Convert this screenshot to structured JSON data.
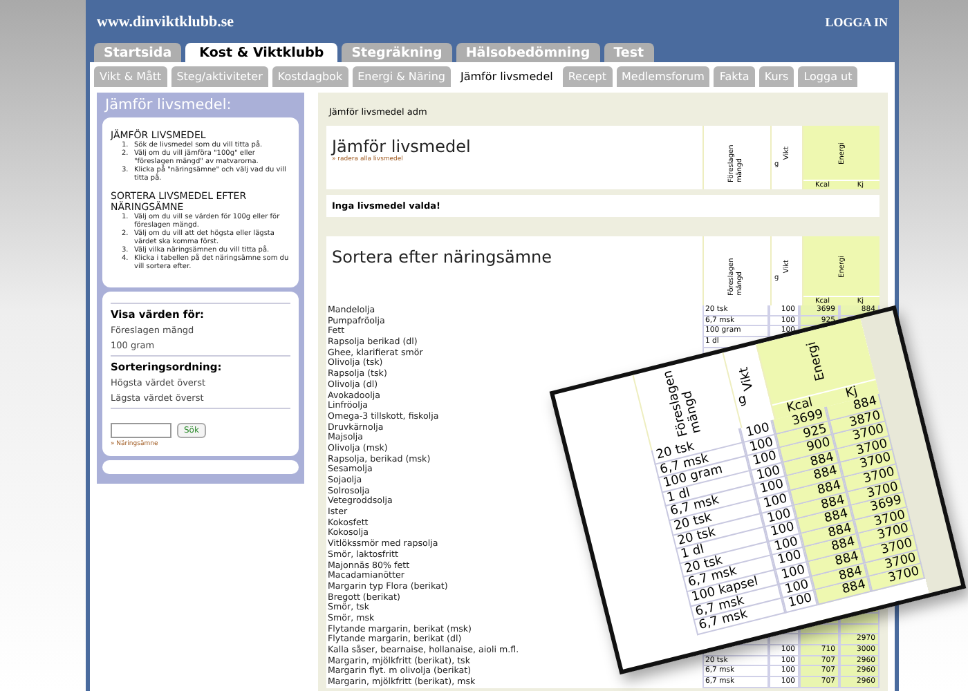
{
  "header": {
    "site": "www.dinviktklubb.se",
    "login": "LOGGA IN"
  },
  "tabs": [
    {
      "label": "Startsida",
      "selected": false
    },
    {
      "label": "Kost & Viktklubb",
      "selected": true
    },
    {
      "label": "Stegräkning",
      "selected": false
    },
    {
      "label": "Hälsobedömning",
      "selected": false
    },
    {
      "label": "Test",
      "selected": false
    }
  ],
  "subtabs": [
    {
      "label": "Vikt & Mått",
      "selected": false
    },
    {
      "label": "Steg/aktiviteter",
      "selected": false
    },
    {
      "label": "Kostdagbok",
      "selected": false
    },
    {
      "label": "Energi & Näring",
      "selected": false
    },
    {
      "label": "Jämför livsmedel",
      "selected": true
    },
    {
      "label": "Recept",
      "selected": false
    },
    {
      "label": "Medlemsforum",
      "selected": false
    },
    {
      "label": "Fakta",
      "selected": false
    },
    {
      "label": "Kurs",
      "selected": false
    },
    {
      "label": "Logga ut",
      "selected": false
    }
  ],
  "sidebar": {
    "title": "Jämför livsmedel:",
    "sections": [
      {
        "heading": "JÄMFÖR LIVSMEDEL",
        "steps": [
          {
            "number": "1.",
            "text": "Sök de livsmedel som du vill titta på."
          },
          {
            "number": "2.",
            "text": "Välj om du vill jämföra \"100g\" eller \"föreslagen mängd\" av matvarorna."
          },
          {
            "number": "3.",
            "text": "Klicka på \"näringsämne\" och välj vad du vill titta på."
          }
        ]
      },
      {
        "heading": "SORTERA LIVSMEDEL EFTER NÄRINGSÄMNE",
        "steps": [
          {
            "number": "1.",
            "text": "Välj om du vill se värden för 100g eller för föreslagen mängd."
          },
          {
            "number": "2.",
            "text": "Välj om du vill att det högsta eller lägsta värdet ska komma först."
          },
          {
            "number": "3.",
            "text": "Välj vilka näringsämnen du vill titta på."
          },
          {
            "number": "4.",
            "text": "Klicka i tabellen på det näringsämne som du vill sortera efter."
          }
        ]
      }
    ],
    "options": [
      {
        "kind": "heading",
        "text": "Visa värden för:"
      },
      {
        "kind": "option",
        "text": "Föreslagen mängd"
      },
      {
        "kind": "option",
        "text": "100 gram"
      },
      {
        "kind": "heading",
        "text": "Sorteringsordning:"
      },
      {
        "kind": "option",
        "text": "Högsta värdet överst"
      },
      {
        "kind": "option",
        "text": "Lägsta värdet överst"
      }
    ],
    "search_button": "Sök",
    "link": "» Näringsämne"
  },
  "main": {
    "title": "Jämför livsmedel adm",
    "compare": {
      "heading": "Jämför livsmedel",
      "link": "» radera alla livsmedel",
      "columns": {
        "amount": "Föreslagen mängd",
        "weight": "Vikt",
        "unit": "g",
        "energy": "Energi",
        "kcal": "Kcal",
        "kj": "Kj"
      }
    },
    "message": "Inga livsmedel valda!",
    "sort": {
      "heading": "Sortera efter näringsämne",
      "columns": {
        "amount": "Föreslagen mängd",
        "weight": "Vikt",
        "unit": "g",
        "energy": "Energi",
        "kcal": "Kcal",
        "kj": "Kj"
      },
      "rows": [
        {
          "name": "Mandelolja",
          "amount": "20 tsk",
          "weight": "100",
          "kcal": "3699",
          "kj": "884"
        },
        {
          "name": "Pumpafröolja",
          "amount": "6,7 msk",
          "weight": "100",
          "kcal": "925"
        },
        {
          "name": "Fett",
          "amount": "100 gram",
          "weight": "100"
        },
        {
          "name": "Rapsolja berikad (dl)",
          "amount": "1 dl"
        },
        {
          "name": "Ghee, klarifierat smör"
        },
        {
          "name": "Olivolja (tsk)"
        },
        {
          "name": "Rapsolja (tsk)"
        },
        {
          "name": "Olivolja (dl)"
        },
        {
          "name": "Avokadoolja"
        },
        {
          "name": "Linfröolja"
        },
        {
          "name": "Omega-3 tillskott, fiskolja"
        },
        {
          "name": "Druvkärnolja"
        },
        {
          "name": "Majsolja"
        },
        {
          "name": "Olivolja (msk)"
        },
        {
          "name": "Rapsolja, berikad (msk)"
        },
        {
          "name": "Sesamolja"
        },
        {
          "name": "Sojaolja"
        },
        {
          "name": "Solrosolja"
        },
        {
          "name": "Vetegroddsolja"
        },
        {
          "name": "Ister"
        },
        {
          "name": "Kokosfett"
        },
        {
          "name": "Kokosolja"
        },
        {
          "name": "Vitlökssmör med rapsolja"
        },
        {
          "name": "Smör, laktosfritt"
        },
        {
          "name": "Majonnäs 80% fett"
        },
        {
          "name": "Macadamianötter"
        },
        {
          "name": "Margarin typ Flora (berikat)"
        },
        {
          "name": "Bregott (berikat)"
        },
        {
          "name": "Smör, tsk"
        },
        {
          "name": "Smör, msk"
        },
        {
          "name": "Flytande margarin, berikat (msk)"
        },
        {
          "name": "Flytande margarin, berikat (dl)",
          "kj": "2970"
        },
        {
          "name": "Kalla såser, bearnaise, hollanaise, aioli m.fl.",
          "weight": "100",
          "kcal": "710",
          "kj": "3000"
        },
        {
          "name": "Margarin, mjölkfritt (berikat), tsk",
          "amount": "20 tsk",
          "weight": "100",
          "kcal": "707",
          "kj": "2960"
        },
        {
          "name": "Margarin flyt. m olivolja (berikat)",
          "amount": "6,7 msk",
          "weight": "100",
          "kcal": "707",
          "kj": "2960"
        },
        {
          "name": "Margarin, mjölkfritt (berikat), msk",
          "amount": "6,7 msk",
          "weight": "100",
          "kcal": "707",
          "kj": "2960"
        }
      ]
    }
  },
  "zoom_inset": {
    "columns": {
      "amount": "Föreslagen mängd",
      "weight": "Vikt",
      "unit": "g",
      "energy": "Energi",
      "kcal": "Kcal",
      "kj": "Kj"
    },
    "rows": [
      {
        "amount": "20 tsk",
        "weight": "100",
        "kcal": "3699",
        "kj": "884"
      },
      {
        "amount": "6,7 msk",
        "weight": "100",
        "kcal": "925",
        "kj": "3870"
      },
      {
        "amount": "100 gram",
        "weight": "100",
        "kcal": "900",
        "kj": "3700"
      },
      {
        "amount": "1 dl",
        "weight": "100",
        "kcal": "884",
        "kj": "3700"
      },
      {
        "amount": "6,7 msk",
        "weight": "100",
        "kcal": "884",
        "kj": "3700"
      },
      {
        "amount": "20 tsk",
        "weight": "100",
        "kcal": "884",
        "kj": "3700"
      },
      {
        "amount": "20 tsk",
        "weight": "100",
        "kcal": "884",
        "kj": "3700"
      },
      {
        "amount": "1 dl",
        "weight": "100",
        "kcal": "884",
        "kj": "3699"
      },
      {
        "amount": "20 tsk",
        "weight": "100",
        "kcal": "884",
        "kj": "3700"
      },
      {
        "amount": "6,7 msk",
        "weight": "100",
        "kcal": "884",
        "kj": "3700"
      },
      {
        "amount": "100 kapsel",
        "weight": "100",
        "kcal": "884",
        "kj": "3700"
      },
      {
        "amount": "6,7 msk",
        "weight": "100",
        "kcal": "884",
        "kj": "3700"
      },
      {
        "amount": "6,7 msk",
        "weight": "100",
        "kcal": "884",
        "kj": "3700"
      }
    ]
  }
}
